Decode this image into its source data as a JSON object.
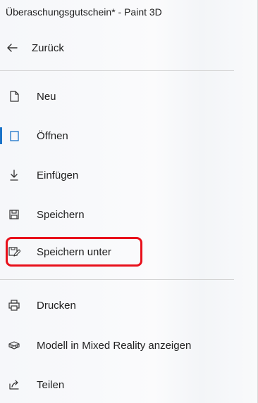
{
  "window": {
    "title": "Überaschungsgutschein* - Paint 3D"
  },
  "menu": {
    "back": {
      "label": "Zurück",
      "icon": "arrow-left-icon"
    },
    "items": [
      {
        "label": "Neu",
        "icon": "new-file-icon"
      },
      {
        "label": "Öffnen",
        "icon": "open-file-icon"
      },
      {
        "label": "Einfügen",
        "icon": "insert-download-icon"
      },
      {
        "label": "Speichern",
        "icon": "save-icon"
      },
      {
        "label": "Speichern unter",
        "icon": "save-as-icon"
      },
      {
        "label": "Drucken",
        "icon": "print-icon"
      },
      {
        "label": "Modell in Mixed Reality anzeigen",
        "icon": "mixed-reality-icon"
      },
      {
        "label": "Teilen",
        "icon": "share-icon"
      }
    ]
  },
  "colors": {
    "accent": "#1a73c8",
    "highlight_border": "#e8101b"
  }
}
